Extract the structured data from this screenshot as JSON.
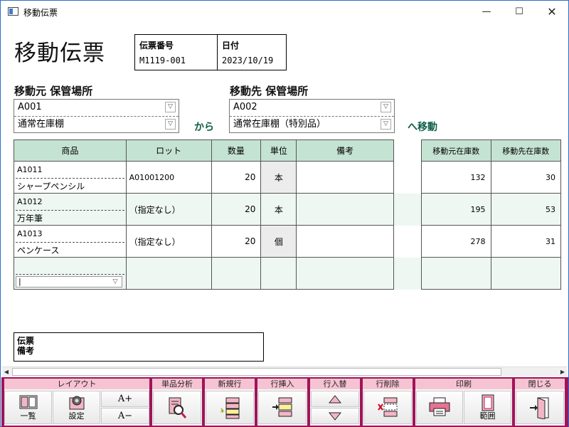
{
  "window": {
    "title": "移動伝票"
  },
  "heading": "移動伝票",
  "header": {
    "slip_no_label": "伝票番号",
    "slip_no": "M1119-001",
    "date_label": "日付",
    "date": "2023/10/19"
  },
  "source": {
    "label": "移動元 保管場所",
    "code": "A001",
    "name": "通常在庫棚"
  },
  "kara": "から",
  "dest": {
    "label": "移動先 保管場所",
    "code": "A002",
    "name": "通常在庫棚（特別品）"
  },
  "he_ido": "へ移動",
  "table": {
    "headers": [
      "商品",
      "ロット",
      "数量",
      "単位",
      "備考"
    ],
    "stock_headers": [
      "移動元在庫数",
      "移動先在庫数"
    ],
    "rows": [
      {
        "code": "A1011",
        "name": "シャープペンシル",
        "lot": "A01001200",
        "qty": "20",
        "unit": "本",
        "note": "",
        "src_stock": "132",
        "dst_stock": "30"
      },
      {
        "code": "A1012",
        "name": "万年筆",
        "lot": "（指定なし）",
        "qty": "20",
        "unit": "本",
        "note": "",
        "src_stock": "195",
        "dst_stock": "53"
      },
      {
        "code": "A1013",
        "name": "ペンケース",
        "lot": "（指定なし）",
        "qty": "20",
        "unit": "個",
        "note": "",
        "src_stock": "278",
        "dst_stock": "31"
      }
    ]
  },
  "remarks_label": "伝票\n備考",
  "toolbar": {
    "layout": {
      "title": "レイアウト",
      "list": "一覧",
      "settings": "設定",
      "font_up": "A+",
      "font_down": "A−"
    },
    "analysis": {
      "title": "単品分析"
    },
    "new_row": {
      "title": "新規行"
    },
    "insert_row": {
      "title": "行挿入"
    },
    "swap_row": {
      "title": "行入替"
    },
    "delete_row": {
      "title": "行削除"
    },
    "print": {
      "title": "印刷",
      "range": "範囲"
    },
    "close": {
      "title": "閉じる"
    }
  },
  "colors": {
    "accent": "#a0145a",
    "header_green": "#c5e3d3",
    "group_title_pink": "#f6c3d2",
    "label_green": "#0f5e48"
  }
}
